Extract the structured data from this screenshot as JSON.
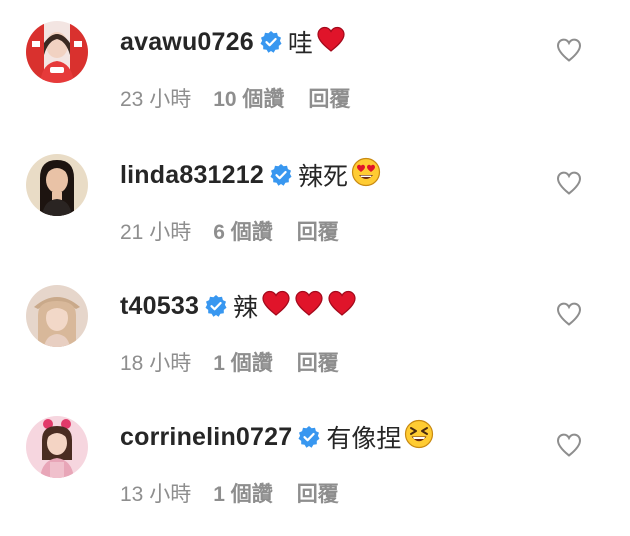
{
  "comments": [
    {
      "username": "avawu0726",
      "text": "哇",
      "emojis": [
        "red-heart"
      ],
      "time": "23 小時",
      "likes": "10 個讚",
      "reply_label": "回覆"
    },
    {
      "username": "linda831212",
      "text": "辣死",
      "emojis": [
        "heart-eyes"
      ],
      "time": "21 小時",
      "likes": "6 個讚",
      "reply_label": "回覆"
    },
    {
      "username": "t40533",
      "text": "辣",
      "emojis": [
        "red-heart",
        "red-heart",
        "red-heart"
      ],
      "time": "18 小時",
      "likes": "1 個讚",
      "reply_label": "回覆"
    },
    {
      "username": "corrinelin0727",
      "text": "有像捏",
      "emojis": [
        "squinting-laugh"
      ],
      "time": "13 小時",
      "likes": "1 個讚",
      "reply_label": "回覆"
    }
  ],
  "colors": {
    "verified_blue": "#3897f0",
    "heart_red": "#e0142a",
    "meta_gray": "#8e8e8e",
    "text_dark": "#262626"
  }
}
